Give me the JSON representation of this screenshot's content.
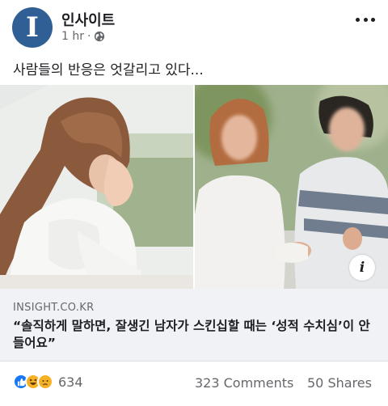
{
  "post": {
    "page_name": "인사이트",
    "avatar_letter": "I",
    "time": "1 hr",
    "separator": "·",
    "privacy_icon": "globe-icon",
    "more_icon": "more-horizontal-icon",
    "text": "사람들의 반응은 엇갈리고 있다..."
  },
  "media": {
    "left_photo": "woman-covering-face-photo",
    "right_photo": "blurred-couple-photo",
    "info_icon_glyph": "i"
  },
  "link": {
    "domain": "INSIGHT.CO.KR",
    "title": "“솔직하게 말하면, 잘생긴 남자가 스킨십할 때는 ‘성적 수치심’이 안 들어요”"
  },
  "engagement": {
    "reaction_icons": [
      "like-icon",
      "haha-icon",
      "sad-icon"
    ],
    "reaction_count": "634",
    "comments": "323 Comments",
    "shares": "50 Shares"
  },
  "colors": {
    "brand_avatar": "#2f5f94",
    "like_blue": "#1877f2",
    "reaction_yellow": "#f7b125",
    "secondary_text": "#65676b",
    "link_box_bg": "#f0f2f5"
  }
}
